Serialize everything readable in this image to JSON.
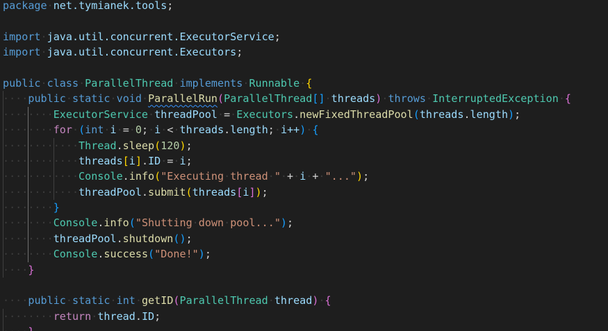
{
  "editor": {
    "language": "java",
    "colors": {
      "background": "#1e1e1e",
      "keyword": "#569cd6",
      "control": "#c586c0",
      "identifier": "#9cdcfe",
      "type": "#4ec9b0",
      "function": "#dcdcaa",
      "number": "#b5cea8",
      "string": "#ce9178",
      "punctuation": "#d4d4d4",
      "whitespace_marker": "#3c3c3c",
      "bracket_level1": "#ffd700",
      "bracket_level2": "#da70d6",
      "bracket_level3": "#179fff"
    },
    "lines": [
      [
        [
          "package",
          "keyword"
        ],
        [
          "·",
          "ws"
        ],
        [
          "net.tymianek.tools",
          "ident"
        ],
        [
          ";",
          "punct"
        ]
      ],
      [],
      [
        [
          "import",
          "keyword"
        ],
        [
          "·",
          "ws"
        ],
        [
          "java.util.concurrent.ExecutorService",
          "ident"
        ],
        [
          ";",
          "punct"
        ]
      ],
      [
        [
          "import",
          "keyword"
        ],
        [
          "·",
          "ws"
        ],
        [
          "java.util.concurrent.Executors",
          "ident"
        ],
        [
          ";",
          "punct"
        ]
      ],
      [],
      [
        [
          "public",
          "keyword"
        ],
        [
          "·",
          "ws"
        ],
        [
          "class",
          "keyword"
        ],
        [
          "·",
          "ws"
        ],
        [
          "ParallelThread",
          "type"
        ],
        [
          "·",
          "ws"
        ],
        [
          "implements",
          "keyword"
        ],
        [
          "·",
          "ws"
        ],
        [
          "Runnable",
          "type"
        ],
        [
          "·",
          "ws"
        ],
        [
          "{",
          "bracket1"
        ]
      ],
      [
        [
          "····",
          "ws"
        ],
        [
          "public",
          "keyword"
        ],
        [
          "·",
          "ws"
        ],
        [
          "static",
          "keyword"
        ],
        [
          "·",
          "ws"
        ],
        [
          "void",
          "keyword"
        ],
        [
          "·",
          "ws"
        ],
        [
          "ParallelRun",
          "func squiggle"
        ],
        [
          "(",
          "bracket2"
        ],
        [
          "ParallelThread",
          "type"
        ],
        [
          "[]",
          "bracket3"
        ],
        [
          "·",
          "ws"
        ],
        [
          "threads",
          "ident"
        ],
        [
          ")",
          "bracket2"
        ],
        [
          "·",
          "ws"
        ],
        [
          "throws",
          "keyword"
        ],
        [
          "·",
          "ws"
        ],
        [
          "InterruptedException",
          "type"
        ],
        [
          "·",
          "ws"
        ],
        [
          "{",
          "bracket2"
        ]
      ],
      [
        [
          "········",
          "ws"
        ],
        [
          "ExecutorService",
          "type"
        ],
        [
          "·",
          "ws"
        ],
        [
          "threadPool",
          "ident"
        ],
        [
          "·",
          "ws"
        ],
        [
          "=",
          "punct"
        ],
        [
          "·",
          "ws"
        ],
        [
          "Executors",
          "type"
        ],
        [
          ".",
          "punct"
        ],
        [
          "newFixedThreadPool",
          "func"
        ],
        [
          "(",
          "bracket3"
        ],
        [
          "threads",
          "ident"
        ],
        [
          ".",
          "punct"
        ],
        [
          "length",
          "ident"
        ],
        [
          ")",
          "bracket3"
        ],
        [
          ";",
          "punct"
        ]
      ],
      [
        [
          "········",
          "ws"
        ],
        [
          "for",
          "control"
        ],
        [
          "·",
          "ws"
        ],
        [
          "(",
          "bracket3"
        ],
        [
          "int",
          "keyword"
        ],
        [
          "·",
          "ws"
        ],
        [
          "i",
          "ident"
        ],
        [
          "·",
          "ws"
        ],
        [
          "=",
          "punct"
        ],
        [
          "·",
          "ws"
        ],
        [
          "0",
          "number"
        ],
        [
          ";",
          "punct"
        ],
        [
          "·",
          "ws"
        ],
        [
          "i",
          "ident"
        ],
        [
          "·",
          "ws"
        ],
        [
          "<",
          "punct"
        ],
        [
          "·",
          "ws"
        ],
        [
          "threads",
          "ident"
        ],
        [
          ".",
          "punct"
        ],
        [
          "length",
          "ident"
        ],
        [
          ";",
          "punct"
        ],
        [
          "·",
          "ws"
        ],
        [
          "i++",
          "ident"
        ],
        [
          ")",
          "bracket3"
        ],
        [
          "·",
          "ws"
        ],
        [
          "{",
          "bracket3"
        ]
      ],
      [
        [
          "············",
          "ws"
        ],
        [
          "Thread",
          "type"
        ],
        [
          ".",
          "punct"
        ],
        [
          "sleep",
          "func"
        ],
        [
          "(",
          "bracket1"
        ],
        [
          "120",
          "number"
        ],
        [
          ")",
          "bracket1"
        ],
        [
          ";",
          "punct"
        ]
      ],
      [
        [
          "············",
          "ws"
        ],
        [
          "threads",
          "ident"
        ],
        [
          "[",
          "bracket1"
        ],
        [
          "i",
          "ident"
        ],
        [
          "]",
          "bracket1"
        ],
        [
          ".",
          "punct"
        ],
        [
          "ID",
          "ident"
        ],
        [
          "·",
          "ws"
        ],
        [
          "=",
          "punct"
        ],
        [
          "·",
          "ws"
        ],
        [
          "i",
          "ident"
        ],
        [
          ";",
          "punct"
        ]
      ],
      [
        [
          "············",
          "ws"
        ],
        [
          "Console",
          "type"
        ],
        [
          ".",
          "punct"
        ],
        [
          "info",
          "func"
        ],
        [
          "(",
          "bracket1"
        ],
        [
          "\"Executing",
          "string"
        ],
        [
          "·",
          "ws"
        ],
        [
          "thread",
          "string"
        ],
        [
          "·",
          "ws"
        ],
        [
          "\"",
          "string"
        ],
        [
          "·",
          "ws"
        ],
        [
          "+",
          "punct"
        ],
        [
          "·",
          "ws"
        ],
        [
          "i",
          "ident"
        ],
        [
          "·",
          "ws"
        ],
        [
          "+",
          "punct"
        ],
        [
          "·",
          "ws"
        ],
        [
          "\"...\"",
          "string"
        ],
        [
          ")",
          "bracket1"
        ],
        [
          ";",
          "punct"
        ]
      ],
      [
        [
          "············",
          "ws"
        ],
        [
          "threadPool",
          "ident"
        ],
        [
          ".",
          "punct"
        ],
        [
          "submit",
          "func"
        ],
        [
          "(",
          "bracket1"
        ],
        [
          "threads",
          "ident"
        ],
        [
          "[",
          "bracket2"
        ],
        [
          "i",
          "ident"
        ],
        [
          "]",
          "bracket2"
        ],
        [
          ")",
          "bracket1"
        ],
        [
          ";",
          "punct"
        ]
      ],
      [
        [
          "········",
          "ws"
        ],
        [
          "}",
          "bracket3"
        ]
      ],
      [
        [
          "········",
          "ws"
        ],
        [
          "Console",
          "type"
        ],
        [
          ".",
          "punct"
        ],
        [
          "info",
          "func"
        ],
        [
          "(",
          "bracket3"
        ],
        [
          "\"Shutting",
          "string"
        ],
        [
          "·",
          "ws"
        ],
        [
          "down",
          "string"
        ],
        [
          "·",
          "ws"
        ],
        [
          "pool...\"",
          "string"
        ],
        [
          ")",
          "bracket3"
        ],
        [
          ";",
          "punct"
        ]
      ],
      [
        [
          "········",
          "ws"
        ],
        [
          "threadPool",
          "ident"
        ],
        [
          ".",
          "punct"
        ],
        [
          "shutdown",
          "func"
        ],
        [
          "()",
          "bracket3"
        ],
        [
          ";",
          "punct"
        ]
      ],
      [
        [
          "········",
          "ws"
        ],
        [
          "Console",
          "type"
        ],
        [
          ".",
          "punct"
        ],
        [
          "success",
          "func"
        ],
        [
          "(",
          "bracket3"
        ],
        [
          "\"Done!\"",
          "string"
        ],
        [
          ")",
          "bracket3"
        ],
        [
          ";",
          "punct"
        ]
      ],
      [
        [
          "····",
          "ws"
        ],
        [
          "}",
          "bracket2"
        ]
      ],
      [],
      [
        [
          "····",
          "ws"
        ],
        [
          "public",
          "keyword"
        ],
        [
          "·",
          "ws"
        ],
        [
          "static",
          "keyword"
        ],
        [
          "·",
          "ws"
        ],
        [
          "int",
          "keyword"
        ],
        [
          "·",
          "ws"
        ],
        [
          "getID",
          "func"
        ],
        [
          "(",
          "bracket2"
        ],
        [
          "ParallelThread",
          "type"
        ],
        [
          "·",
          "ws"
        ],
        [
          "thread",
          "ident"
        ],
        [
          ")",
          "bracket2"
        ],
        [
          "·",
          "ws"
        ],
        [
          "{",
          "bracket2"
        ]
      ],
      [
        [
          "········",
          "ws"
        ],
        [
          "return",
          "control"
        ],
        [
          "·",
          "ws"
        ],
        [
          "thread",
          "ident"
        ],
        [
          ".",
          "punct"
        ],
        [
          "ID",
          "ident"
        ],
        [
          ";",
          "punct"
        ]
      ],
      [
        [
          "····",
          "ws"
        ],
        [
          "}",
          "bracket2"
        ]
      ]
    ]
  }
}
